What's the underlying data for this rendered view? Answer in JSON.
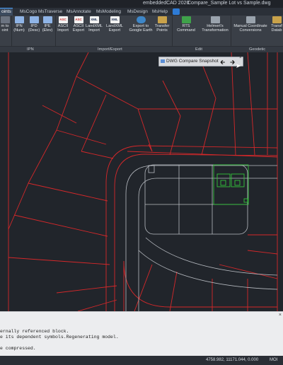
{
  "title_bar": {
    "app": "embeddedCAD 2020",
    "document": "Compare_Sample Lot vs Sample.dwg"
  },
  "tabs": [
    {
      "label": "oints",
      "active": true
    },
    {
      "label": "MsCogo"
    },
    {
      "label": "MsTraverse"
    },
    {
      "label": "MsAnnotate"
    },
    {
      "label": "MsModeling"
    },
    {
      "label": "MsDesign"
    },
    {
      "label": "MsHelp"
    }
  ],
  "ribbon": {
    "buttons": [
      {
        "label": "m to",
        "label2": "oint",
        "icon": "point-icon"
      },
      {
        "label": "IPN",
        "label2": "(Num)",
        "icon": "import-points-number-icon"
      },
      {
        "label": "IPD",
        "label2": "(Desc)",
        "icon": "import-points-desc-icon"
      },
      {
        "label": "IPE",
        "label2": "(Elev)",
        "icon": "import-points-elev-icon"
      },
      {
        "label": "ASCII",
        "label2": "Import",
        "icon": "ascii-import-icon",
        "badge": "ASC"
      },
      {
        "label": "ASCII",
        "label2": "Export",
        "icon": "ascii-export-icon",
        "badge": "ASC"
      },
      {
        "label": "LandXML",
        "label2": "Import",
        "icon": "landxml-import-icon",
        "badge": "XML"
      },
      {
        "label": "LandXML",
        "label2": "Export",
        "icon": "landxml-export-icon",
        "badge": "XML"
      },
      {
        "label": "Export to",
        "label2": "Google Earth",
        "icon": "google-earth-icon"
      },
      {
        "label": "Transfer",
        "label2": "Points",
        "icon": "transfer-points-icon"
      },
      {
        "label": "RTS",
        "label2": "Command",
        "icon": "rts-command-icon"
      },
      {
        "label": "Helmert's",
        "label2": "Transformation",
        "icon": "helmert-icon"
      },
      {
        "label": "Manual Coordinate",
        "label2": "Conversions",
        "icon": "coordinate-conversion-icon"
      },
      {
        "label": "Transf",
        "label2": "Datab",
        "icon": "transform-database-icon"
      }
    ],
    "panels": [
      {
        "label": "IPN"
      },
      {
        "label": "Import/Export"
      },
      {
        "label": "Edit"
      },
      {
        "label": "Geodetic"
      }
    ]
  },
  "snapshot_toolbar": {
    "label": "DWG Compare Snapshot",
    "prev_icon": "arrow-left-icon",
    "next_icon": "arrow-right-icon",
    "close_icon": "close-icon",
    "close": "×",
    "prev": "🡰",
    "next": "🡲"
  },
  "command_line": {
    "lines": [
      "ernally referenced block.",
      "e its dependent symbols.Regenerating model.",
      "",
      "e compressed."
    ],
    "close": "×"
  },
  "status_bar": {
    "coordinates": "4758.982, 11171.044, 0.000",
    "model_label": "MOI"
  },
  "colors": {
    "background": "#21252b",
    "ribbon": "#3a3f47",
    "accent": "#4aa3ff",
    "lot_lines": "#d5282a",
    "road_lines": "#b8bcc2",
    "building": "#33c43a",
    "command_bg": "#ecedef"
  }
}
